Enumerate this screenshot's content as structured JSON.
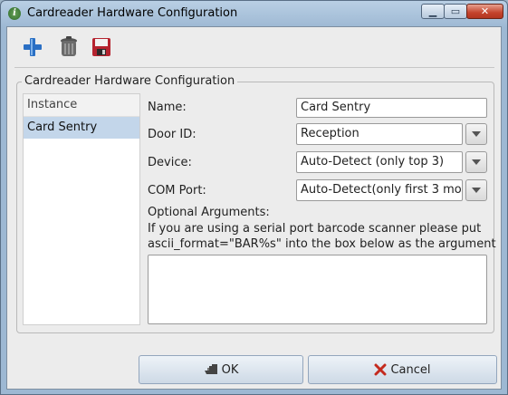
{
  "window": {
    "title": "Cardreader Hardware Configuration",
    "app_icon_glyph": "i"
  },
  "toolbar": {
    "icons": [
      "add-icon",
      "trash-icon",
      "save-icon"
    ]
  },
  "group": {
    "title": "Cardreader Hardware Configuration"
  },
  "list": {
    "header": "Instance",
    "items": [
      {
        "label": "Card Sentry",
        "selected": true
      }
    ]
  },
  "form": {
    "name_label": "Name:",
    "name_value": "Card Sentry",
    "door_label": "Door ID:",
    "door_value": "Reception",
    "device_label": "Device:",
    "device_value": "Auto-Detect (only top 3)",
    "com_label": "COM Port:",
    "com_value": "Auto-Detect(only first 3 moc",
    "optional_label": "Optional Arguments:",
    "note_line1": "If you are using a serial port barcode scanner please put",
    "note_line2": "ascii_format=\"BAR%s\" into the box below as the argument",
    "optional_value": ""
  },
  "buttons": {
    "ok_label": "OK",
    "cancel_label": "Cancel"
  },
  "colors": {
    "selection": "#c3d6ea",
    "close_button": "#c4432c",
    "add_icon": "#2a6fc4",
    "cancel_icon": "#c42a1e"
  }
}
